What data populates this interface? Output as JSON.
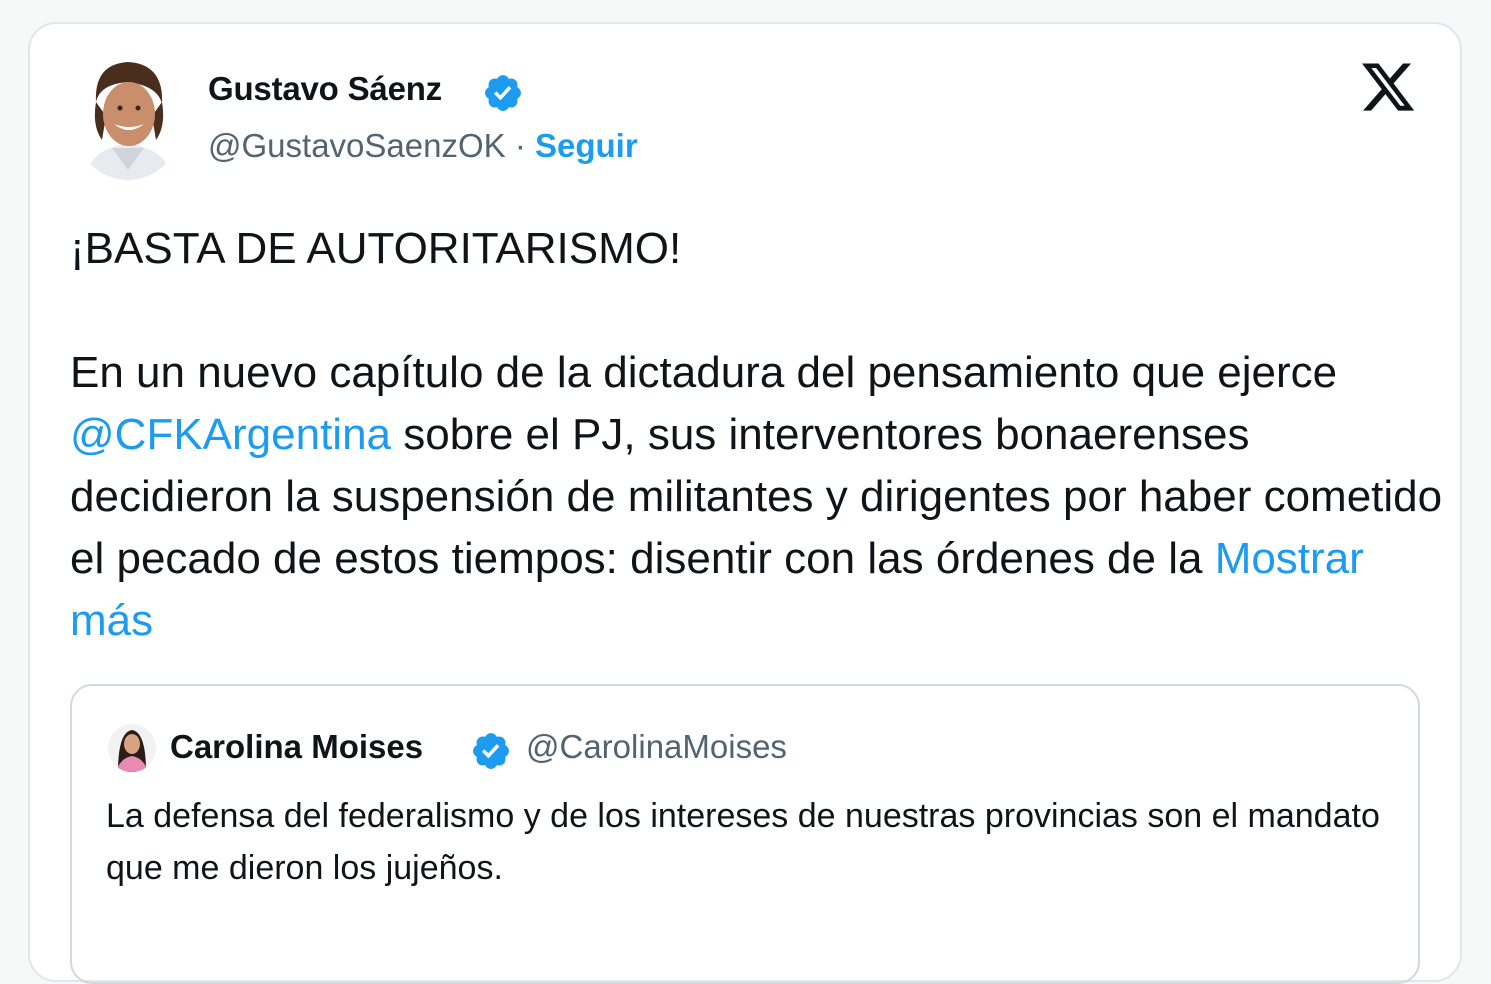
{
  "tweet": {
    "author_name": "Gustavo Sáenz",
    "author_handle": "@GustavoSaenzOK",
    "separator": " · ",
    "follow_label": "Seguir",
    "headline": "¡BASTA DE AUTORITARISMO!",
    "body_before_mention": "En un nuevo capítulo de la dictadura del pensamiento que ejerce ",
    "mention": "@CFKArgentina",
    "body_after_mention": " sobre el PJ, sus interventores bonaerenses decidieron la suspensión de militantes y dirigentes por haber cometido el pecado de estos tiempos: disentir con las órdenes de la ",
    "show_more": "Mostrar más"
  },
  "quoted_tweet": {
    "author_name": "Carolina Moises",
    "author_handle": "@CarolinaMoises",
    "text": "La defensa del federalismo y de los intereses de nuestras provincias son el mandato que me dieron los jujeños."
  },
  "icons": {
    "brand": "x-logo-icon",
    "verified": "verified-badge-icon"
  },
  "colors": {
    "link": "#1d9bf0",
    "secondary_text": "#536471",
    "border": "#cfd9de"
  }
}
